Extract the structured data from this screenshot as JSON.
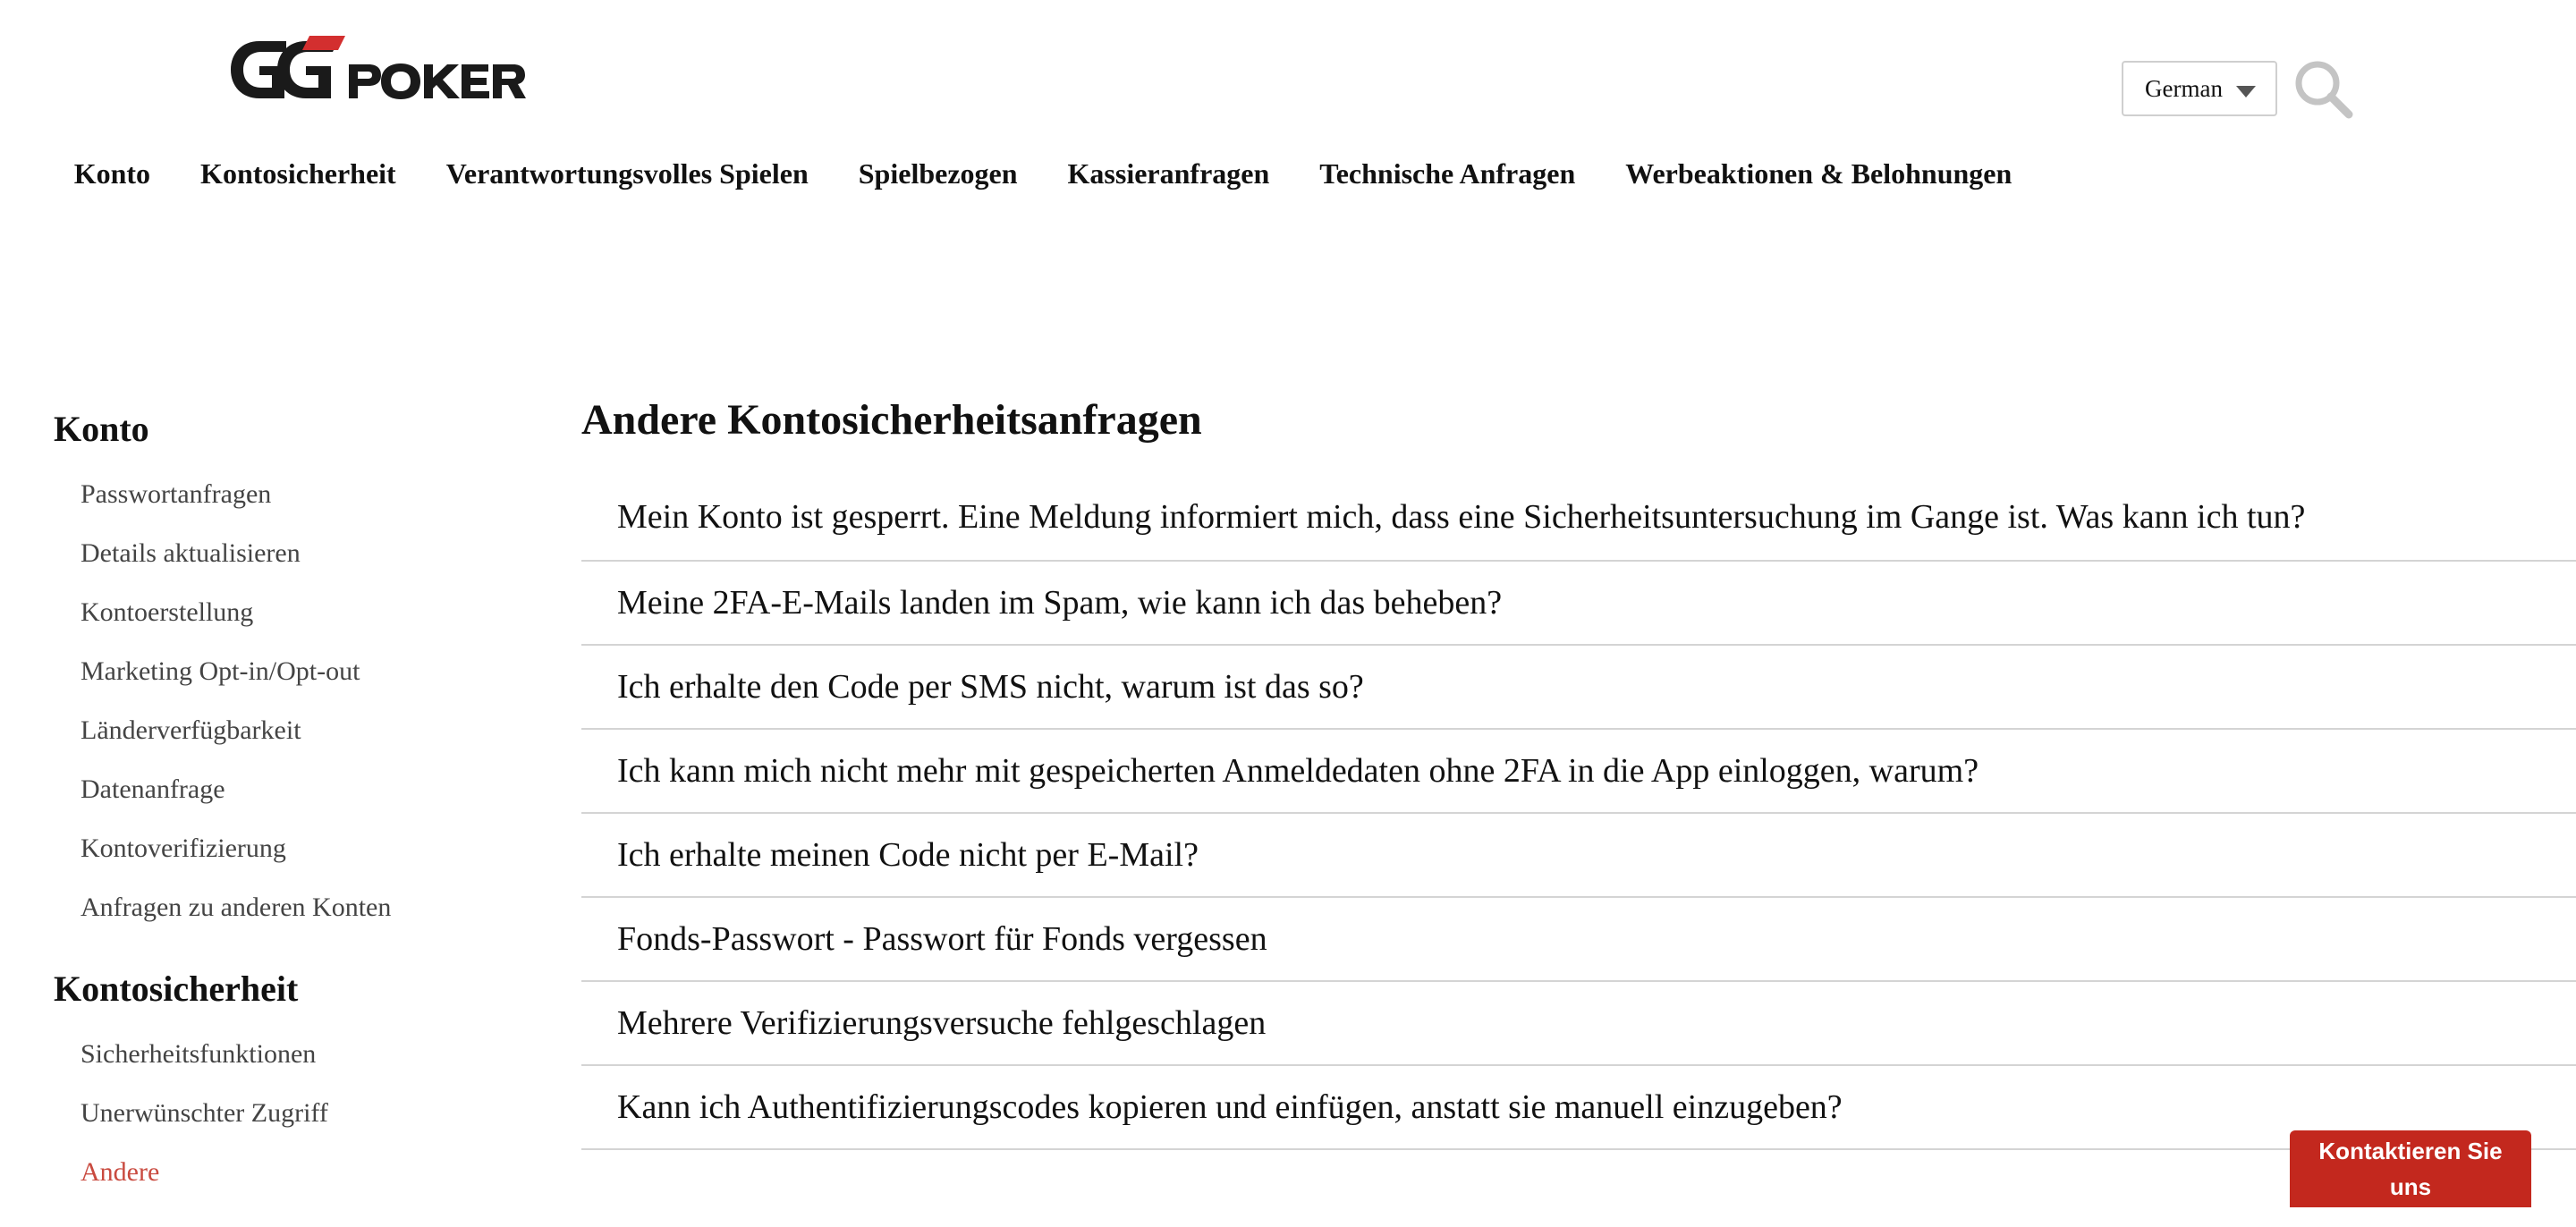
{
  "brand": {
    "logo_text": "GGPOKER",
    "accent_color": "#c3281e"
  },
  "header": {
    "language": "German",
    "nav": [
      "Konto",
      "Kontosicherheit",
      "Verantwortungsvolles Spielen",
      "Spielbezogen",
      "Kassieranfragen",
      "Technische Anfragen",
      "Werbeaktionen & Belohnungen"
    ]
  },
  "sidebar": {
    "sections": [
      {
        "title": "Konto",
        "items": [
          "Passwortanfragen",
          "Details aktualisieren",
          "Kontoerstellung",
          "Marketing Opt-in/Opt-out",
          "Länderverfügbarkeit",
          "Datenanfrage",
          "Kontoverifizierung",
          "Anfragen zu anderen Konten"
        ]
      },
      {
        "title": "Kontosicherheit",
        "items": [
          "Sicherheitsfunktionen",
          "Unerwünschter Zugriff",
          "Andere"
        ],
        "active_item": "Andere"
      }
    ]
  },
  "main": {
    "title": "Andere Kontosicherheitsanfragen",
    "questions": [
      "Mein Konto ist gesperrt. Eine Meldung informiert mich, dass eine Sicherheitsuntersuchung im Gange ist. Was kann ich tun?",
      "Meine 2FA-E-Mails landen im Spam, wie kann ich das beheben?",
      "Ich erhalte den Code per SMS nicht, warum ist das so?",
      "Ich kann mich nicht mehr mit gespeicherten Anmeldedaten ohne 2FA in die App einloggen, warum?",
      "Ich erhalte meinen Code nicht per E-Mail?",
      "Fonds-Passwort - Passwort für Fonds vergessen",
      "Mehrere Verifizierungsversuche fehlgeschlagen",
      "Kann ich Authentifizierungscodes kopieren und einfügen, anstatt sie manuell einzugeben?"
    ]
  },
  "contact_button": {
    "label": "Kontaktieren Sie uns",
    "icon": "none"
  }
}
